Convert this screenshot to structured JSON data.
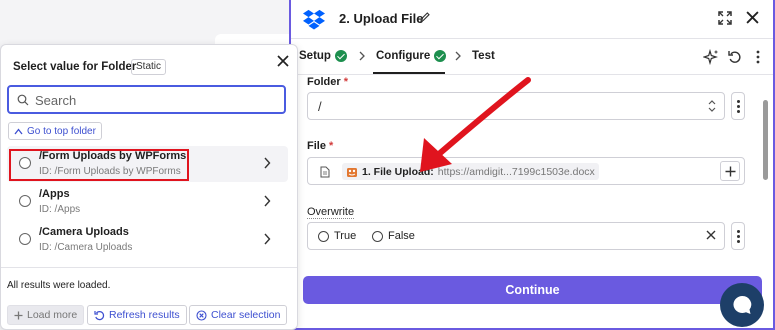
{
  "picker": {
    "title": "Select value for Folder",
    "badge": "Static",
    "search_placeholder": "Search",
    "top_folder_label": "Go to top folder",
    "items": [
      {
        "title": "/Form Uploads by WPForms",
        "subtitle": "ID: /Form Uploads by WPForms"
      },
      {
        "title": "/Apps",
        "subtitle": "ID: /Apps"
      },
      {
        "title": "/Camera Uploads",
        "subtitle": "ID: /Camera Uploads"
      }
    ],
    "status": "All results were loaded.",
    "load_more": "Load more",
    "refresh": "Refresh results",
    "clear": "Clear selection"
  },
  "editor": {
    "step_title": "2. Upload File",
    "tabs": [
      {
        "label": "Setup"
      },
      {
        "label": "Configure"
      },
      {
        "label": "Test"
      }
    ],
    "folder": {
      "label": "Folder",
      "required": "*",
      "value": "/"
    },
    "file": {
      "label": "File",
      "required": "*",
      "chip_label": "1. File Upload:",
      "chip_value": "https://amdigit...7199c1503e.docx"
    },
    "overwrite": {
      "label": "Overwrite",
      "options": [
        "True",
        "False"
      ]
    },
    "continue_label": "Continue"
  },
  "colors": {
    "accent": "#6a5ae0",
    "success": "#1d8f4e",
    "annotation": "#e0141e",
    "chat": "#1d3f68"
  },
  "icons": [
    "dropbox-logo",
    "pencil-icon",
    "expand-icon",
    "close-icon",
    "check-icon",
    "chevron-right-icon",
    "sparkle-icon",
    "undo-icon",
    "more-icon",
    "search-icon",
    "chevron-up-icon",
    "refresh-icon",
    "clear-icon",
    "plus-icon",
    "document-icon",
    "chat-icon"
  ]
}
